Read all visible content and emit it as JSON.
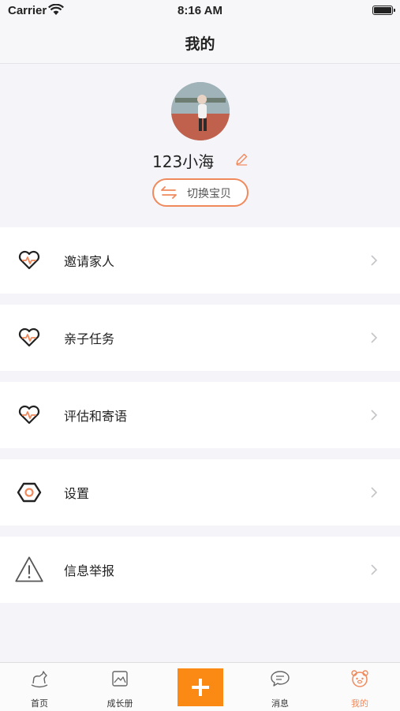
{
  "status_bar": {
    "carrier": "Carrier",
    "time": "8:16 AM"
  },
  "nav": {
    "title": "我的"
  },
  "profile": {
    "username": "123小海",
    "switch_label": "切换宝贝"
  },
  "menu": [
    {
      "label": "邀请家人",
      "icon": "heart-pulse-icon"
    },
    {
      "label": "亲子任务",
      "icon": "heart-pulse-icon"
    },
    {
      "label": "评估和寄语",
      "icon": "heart-pulse-icon"
    },
    {
      "label": "设置",
      "icon": "hex-nut-icon"
    },
    {
      "label": "信息举报",
      "icon": "warning-triangle-icon"
    }
  ],
  "tabs": [
    {
      "label": "首页",
      "icon": "rocking-horse-icon"
    },
    {
      "label": "成长册",
      "icon": "photo-album-icon"
    },
    {
      "label": "",
      "icon": "plus-icon"
    },
    {
      "label": "消息",
      "icon": "chat-bubble-icon"
    },
    {
      "label": "我的",
      "icon": "bear-face-icon"
    }
  ],
  "colors": {
    "accent": "#f08a5d",
    "add_button": "#fa8a13",
    "background": "#f4f4f9"
  }
}
